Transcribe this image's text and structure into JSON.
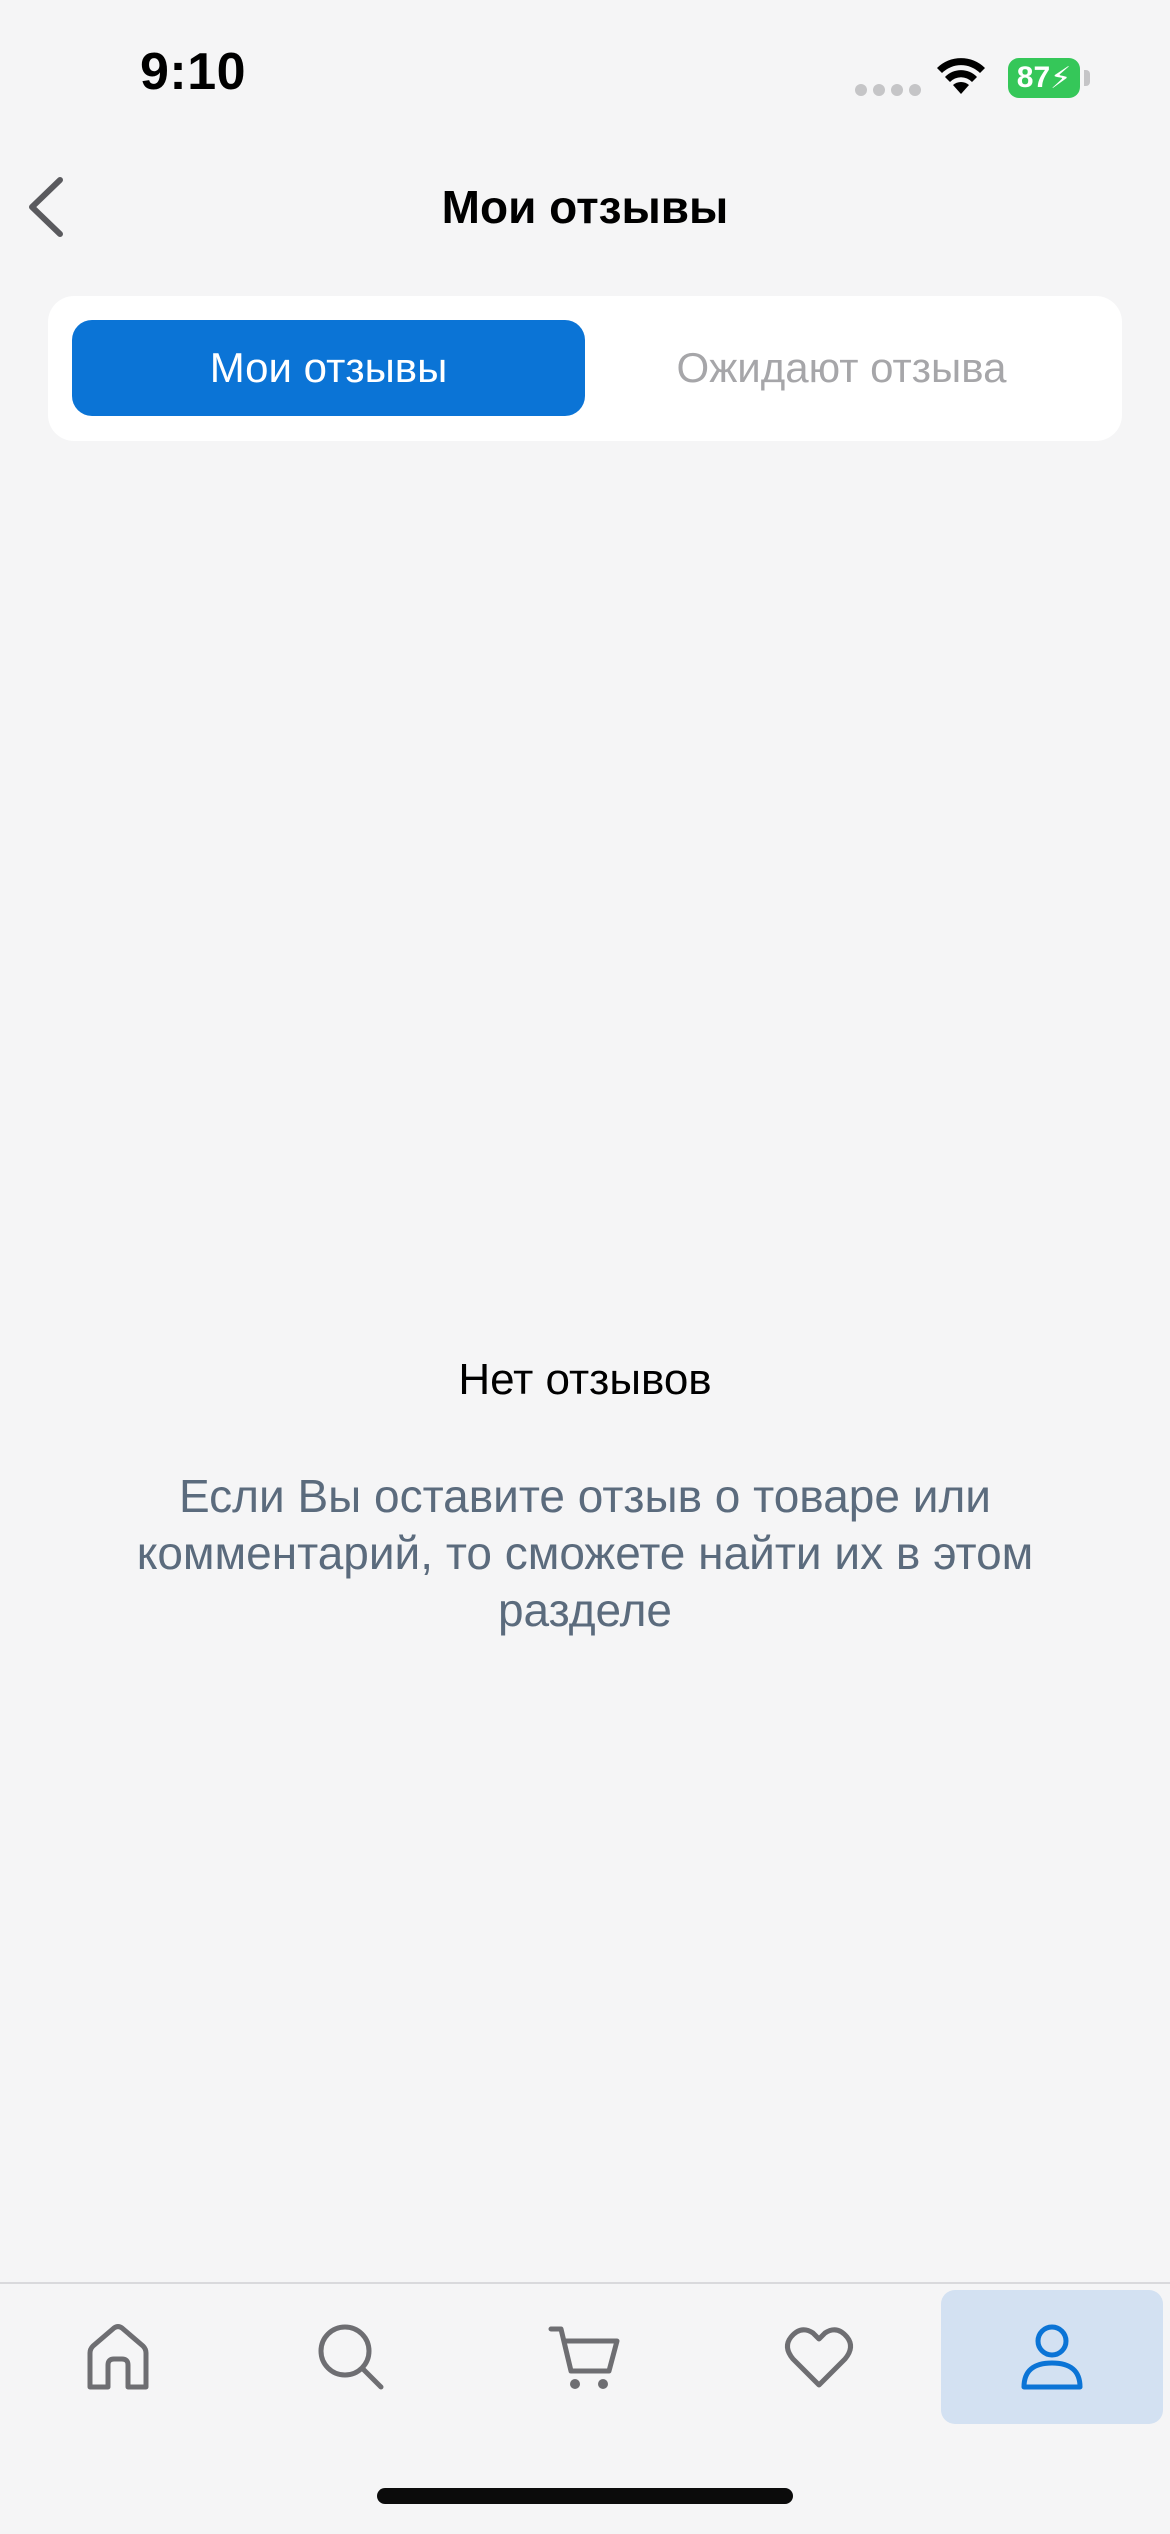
{
  "status_bar": {
    "time": "9:10",
    "battery": "87"
  },
  "header": {
    "title": "Мои отзывы"
  },
  "tabs": [
    {
      "label": "Мои отзывы",
      "active": true
    },
    {
      "label": "Ожидают отзыва",
      "active": false
    }
  ],
  "empty_state": {
    "title": "Нет отзывов",
    "description": "Если Вы оставите отзыв о товаре или комментарий, то сможете найти их в этом разделе"
  },
  "bottom_nav": {
    "items": [
      {
        "icon": "home-icon",
        "active": false
      },
      {
        "icon": "search-icon",
        "active": false
      },
      {
        "icon": "cart-icon",
        "active": false
      },
      {
        "icon": "heart-icon",
        "active": false
      },
      {
        "icon": "profile-icon",
        "active": true
      }
    ]
  },
  "colors": {
    "accent": "#0b74d6",
    "background": "#f5f5f6",
    "inactive_tab_text": "#a6a6a9",
    "description_text": "#5b6b7d",
    "nav_icon": "#6e6e72",
    "nav_active_bg": "#d3e1f2",
    "battery": "#35c759"
  }
}
